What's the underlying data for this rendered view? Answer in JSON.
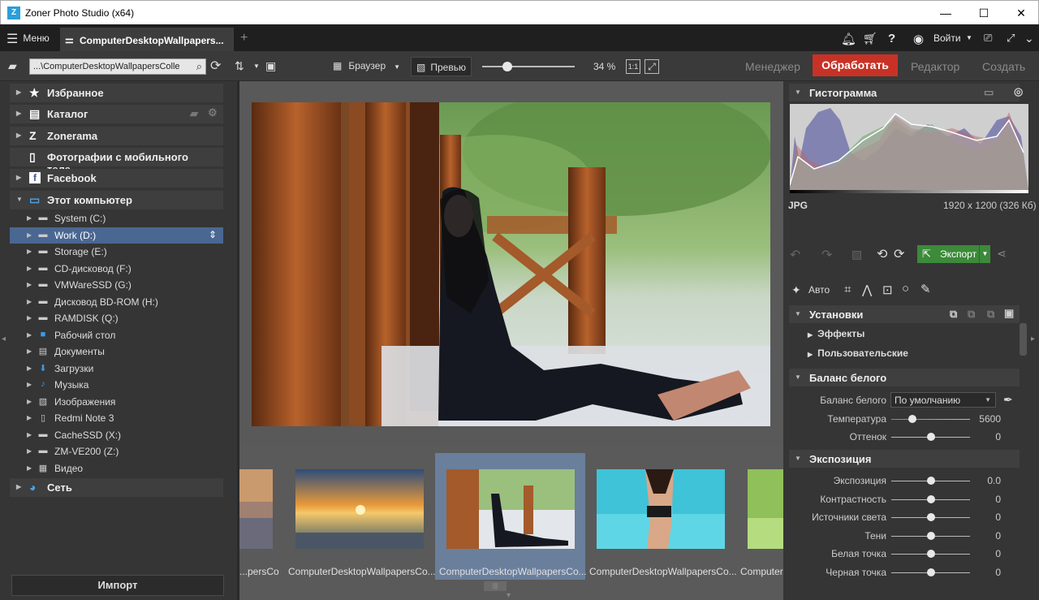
{
  "window": {
    "title": "Zoner Photo Studio (x64)",
    "min": "—",
    "max": "☐",
    "close": "✕"
  },
  "tabs": {
    "menu_label": "Меню",
    "doc_tab": "ComputerDesktopWallpapers...",
    "add": "+",
    "login": "Войти"
  },
  "toolbar": {
    "path": "...\\ComputerDesktopWallpapersColle",
    "browser": "Браузер",
    "preview": "Превью",
    "zoom_percent": "34 %",
    "zoom_level": 0.27,
    "one_to_one": "1:1",
    "modes": {
      "manager": "Менеджер",
      "process": "Обработать",
      "editor": "Редактор",
      "create": "Создать"
    }
  },
  "nav": {
    "sections": [
      {
        "label": "Избранное",
        "icon": "star-icon"
      },
      {
        "label": "Каталог",
        "icon": "catalog-icon"
      },
      {
        "label": "Zonerama",
        "icon": "zonerama-icon"
      },
      {
        "label": "Фотографии с мобильного теле...",
        "icon": "phone-icon"
      },
      {
        "label": "Facebook",
        "icon": "facebook-icon"
      },
      {
        "label": "Этот компьютер",
        "icon": "computer-icon"
      }
    ],
    "drives": [
      "System (C:)",
      "Work (D:)",
      "Storage (E:)",
      "CD-дисковод (F:)",
      "VMWareSSD (G:)",
      "Дисковод BD-ROM (H:)",
      "RAMDISK (Q:)",
      "Рабочий стол",
      "Документы",
      "Загрузки",
      "Музыка",
      "Изображения",
      "Redmi Note 3",
      "CacheSSD (X:)",
      "ZM-VE200 (Z:)",
      "Видео"
    ],
    "network": "Сеть",
    "import": "Импорт"
  },
  "filmstrip": {
    "labels": [
      "...persCo",
      "ComputerDesktopWallpapersCo...",
      "ComputerDesktopWallpapersCo...",
      "ComputerDesktopWallpapersCo...",
      "Computer"
    ]
  },
  "right": {
    "histogram_title": "Гистограмма",
    "format": "JPG",
    "dims": "1920 x 1200 (326 Кб)",
    "export": "Экспорт",
    "auto": "Авто",
    "presets": "Установки",
    "effects": "Эффекты",
    "custom": "Пользовательские",
    "wb_title": "Баланс белого",
    "wb_label": "Баланс белого",
    "wb_value": "По умолчанию",
    "temp_label": "Температура",
    "temp_value": "5600",
    "temp_level": 0.27,
    "tint_label": "Оттенок",
    "tint_value": "0",
    "tint_level": 0.5,
    "exposure_title": "Экспозиция",
    "exposure_sliders": [
      {
        "label": "Экспозиция",
        "value": "0.0",
        "level": 0.5
      },
      {
        "label": "Контрастность",
        "value": "0",
        "level": 0.5
      },
      {
        "label": "Источники света",
        "value": "0",
        "level": 0.5
      },
      {
        "label": "Тени",
        "value": "0",
        "level": 0.5
      },
      {
        "label": "Белая точка",
        "value": "0",
        "level": 0.5
      },
      {
        "label": "Черная точка",
        "value": "0",
        "level": 0.5
      }
    ]
  }
}
